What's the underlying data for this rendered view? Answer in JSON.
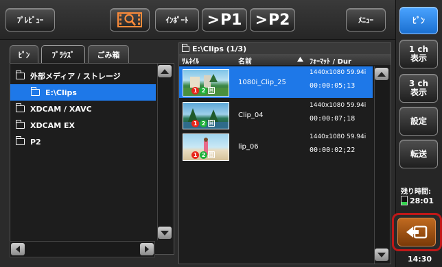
{
  "toolbar": {
    "preview_label": "ﾌﾟﾚﾋﾞｭｰ",
    "search_icon": "film-search-icon",
    "import_label": "ｲﾝﾎﾟｰﾄ",
    "p1_label": "P1",
    "p2_label": "P2",
    "menu_label": "ﾒﾆｭｰ"
  },
  "right": {
    "pin_label": "ﾋﾟﾝ",
    "view1_line1": "1 ch",
    "view1_line2": "表示",
    "view3_line1": "3 ch",
    "view3_line2": "表示",
    "settings_label": "設定",
    "transfer_label": "転送",
    "remaining_label": "残り時間:",
    "remaining_time": "28:01",
    "remaining_fraction": 0.35,
    "clock": "14:30"
  },
  "left": {
    "tabs": [
      "ﾋﾟﾝ",
      "ﾌﾞﾗｳｽﾞ",
      "ごみ箱"
    ],
    "active_tab_index": 1,
    "tree": [
      {
        "label": "外部メディア / ストレージ",
        "selected": false,
        "indent": 0
      },
      {
        "label": "E:\\Clips",
        "selected": true,
        "indent": 1
      },
      {
        "label": "XDCAM / XAVC",
        "selected": false,
        "indent": 0
      },
      {
        "label": "XDCAM EX",
        "selected": false,
        "indent": 0
      },
      {
        "label": "P2",
        "selected": false,
        "indent": 0
      }
    ]
  },
  "clips": {
    "path": "E:\\Clips (1/3)",
    "headers": {
      "thumb": "ｻﾑﾈｲﾙ",
      "name": "名前",
      "format": "ﾌｫｰﾏｯﾄ / Dur"
    },
    "rows": [
      {
        "name": "1080i_Clip_25",
        "format": "1440x1080 59.94i",
        "duration": "00:00:05;13",
        "selected": true
      },
      {
        "name": "Clip_04",
        "format": "1440x1080 59.94i",
        "duration": "00:00:07;18",
        "selected": false
      },
      {
        "name": "lip_06",
        "format": "1440x1080 59.94i",
        "duration": "00:00:02;22",
        "selected": false
      }
    ],
    "badge_labels": [
      "1",
      "2",
      "目"
    ]
  },
  "colors": {
    "selection": "#1e78e8",
    "return_button": "#c06a20",
    "highlight_border": "#c01818",
    "remaining_bar": "#2fd24a"
  }
}
